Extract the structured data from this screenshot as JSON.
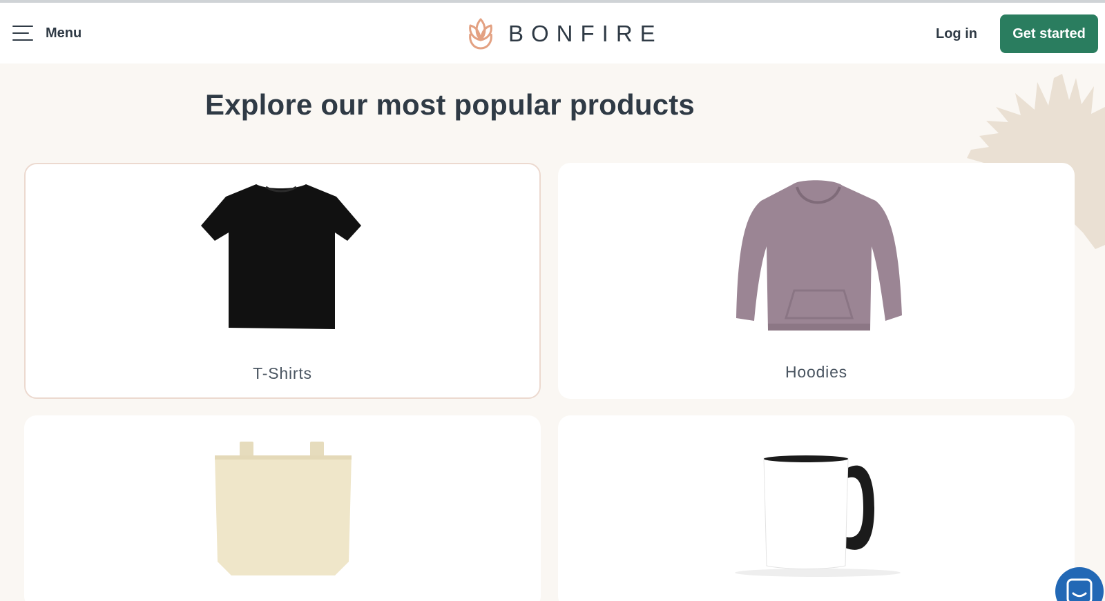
{
  "header": {
    "menu_label": "Menu",
    "brand": "BONFIRE",
    "login_label": "Log in",
    "cta_label": "Get started"
  },
  "main": {
    "title": "Explore our most popular products",
    "products": [
      {
        "label": "T-Shirts",
        "icon": "tshirt-image",
        "color": "#111111"
      },
      {
        "label": "Hoodies",
        "icon": "hoodie-image",
        "color": "#9b8594"
      },
      {
        "label": "",
        "icon": "tote-bag-image",
        "color": "#efe6c9"
      },
      {
        "label": "",
        "icon": "mug-image",
        "color": "#ffffff"
      }
    ]
  },
  "colors": {
    "accent": "#2a7d5f",
    "logo": "#e3a182",
    "background": "#faf7f3",
    "text": "#2f3a45",
    "chat": "#2268b5"
  }
}
